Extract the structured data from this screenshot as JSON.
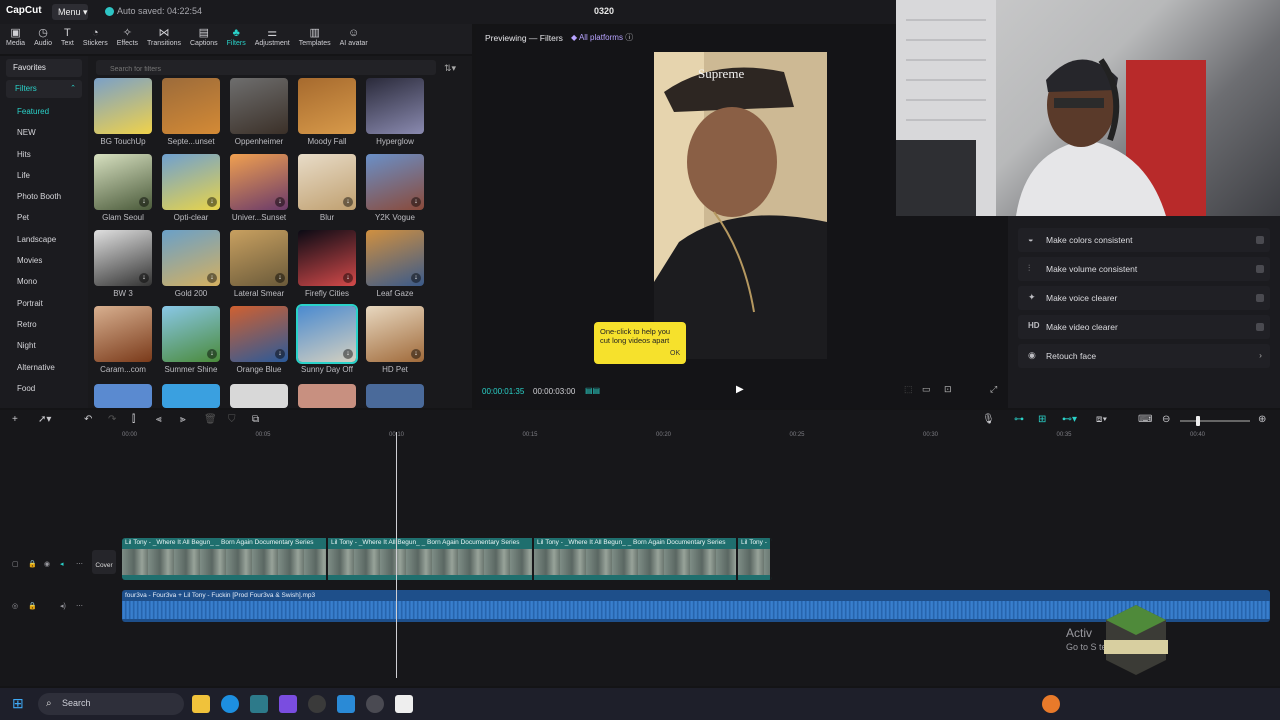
{
  "app": {
    "logo": "CapCut",
    "menu_label": "Menu",
    "autosave": "Auto saved: 04:22:54",
    "project_title": "0320"
  },
  "toolbar": {
    "tools": [
      {
        "label": "Media",
        "icon": "media-icon"
      },
      {
        "label": "Audio",
        "icon": "audio-icon"
      },
      {
        "label": "Text",
        "icon": "text-icon"
      },
      {
        "label": "Stickers",
        "icon": "stickers-icon"
      },
      {
        "label": "Effects",
        "icon": "effects-icon"
      },
      {
        "label": "Transitions",
        "icon": "transitions-icon"
      },
      {
        "label": "Captions",
        "icon": "captions-icon"
      },
      {
        "label": "Filters",
        "icon": "filters-icon",
        "active": true
      },
      {
        "label": "Adjustment",
        "icon": "adjustment-icon"
      },
      {
        "label": "Templates",
        "icon": "templates-icon"
      },
      {
        "label": "AI avatar",
        "icon": "ai-avatar-icon"
      }
    ]
  },
  "categories": {
    "favorites": "Favorites",
    "filters": "Filters",
    "items": [
      "Featured",
      "NEW",
      "Hits",
      "Life",
      "Photo Booth",
      "Pet",
      "Landscape",
      "Movies",
      "Mono",
      "Portrait",
      "Retro",
      "Night",
      "Alternative",
      "Food"
    ]
  },
  "filter_panel": {
    "search_placeholder": "Search for filters",
    "tiles": [
      "BG TouchUp",
      "Septe...unset",
      "Oppenheimer",
      "Moody Fall",
      "Hyperglow",
      "Glam Seoul",
      "Opti-clear",
      "Univer...Sunset",
      "Blur",
      "Y2K Vogue",
      "BW 3",
      "Gold 200",
      "Lateral Smear",
      "Firefly Cities",
      "Leaf Gaze",
      "Caram...com",
      "Summer Shine",
      "Orange Blue",
      "Sunny Day Off",
      "HD Pet"
    ]
  },
  "preview": {
    "title": "Previewing — Filters",
    "badge": "All platforms",
    "tooltip_text": "One-click to help you cut long videos apart",
    "tooltip_ok": "OK",
    "time_current": "00:00:01:35",
    "time_total": "00:00:03:00"
  },
  "right_panel": {
    "items": [
      {
        "label": "Make colors consistent",
        "icon": "palette-icon"
      },
      {
        "label": "Make volume consistent",
        "icon": "volume-bars-icon"
      },
      {
        "label": "Make voice clearer",
        "icon": "sparkle-icon"
      },
      {
        "label": "Make video clearer",
        "icon": "hd-icon",
        "icon_text": "HD"
      },
      {
        "label": "Retouch face",
        "icon": "face-icon"
      }
    ]
  },
  "timeline": {
    "ticks": [
      "00:00",
      "00:05",
      "00:10",
      "00:15",
      "00:20",
      "00:25",
      "00:30",
      "00:35",
      "00:40"
    ],
    "video_clip_label": "Lil Tony - _Where It All Begun_ _ Born Again Documentary Series",
    "video_clip_last_label": "Lil Tony -",
    "cover_label": "Cover",
    "audio_label": "four3va - Four3va + Lil Tony - Fuckin [Prod Four3va & Swish].mp3"
  },
  "overlay": {
    "activate_title": "Activ",
    "activate_sub": "Go to S                           te Windows."
  },
  "taskbar": {
    "search_placeholder": "Search"
  },
  "colors": {
    "accent": "#2ad2c9",
    "audio_track": "#1e4f8a",
    "video_track": "#1f6f6e",
    "tooltip": "#f6e12c"
  }
}
